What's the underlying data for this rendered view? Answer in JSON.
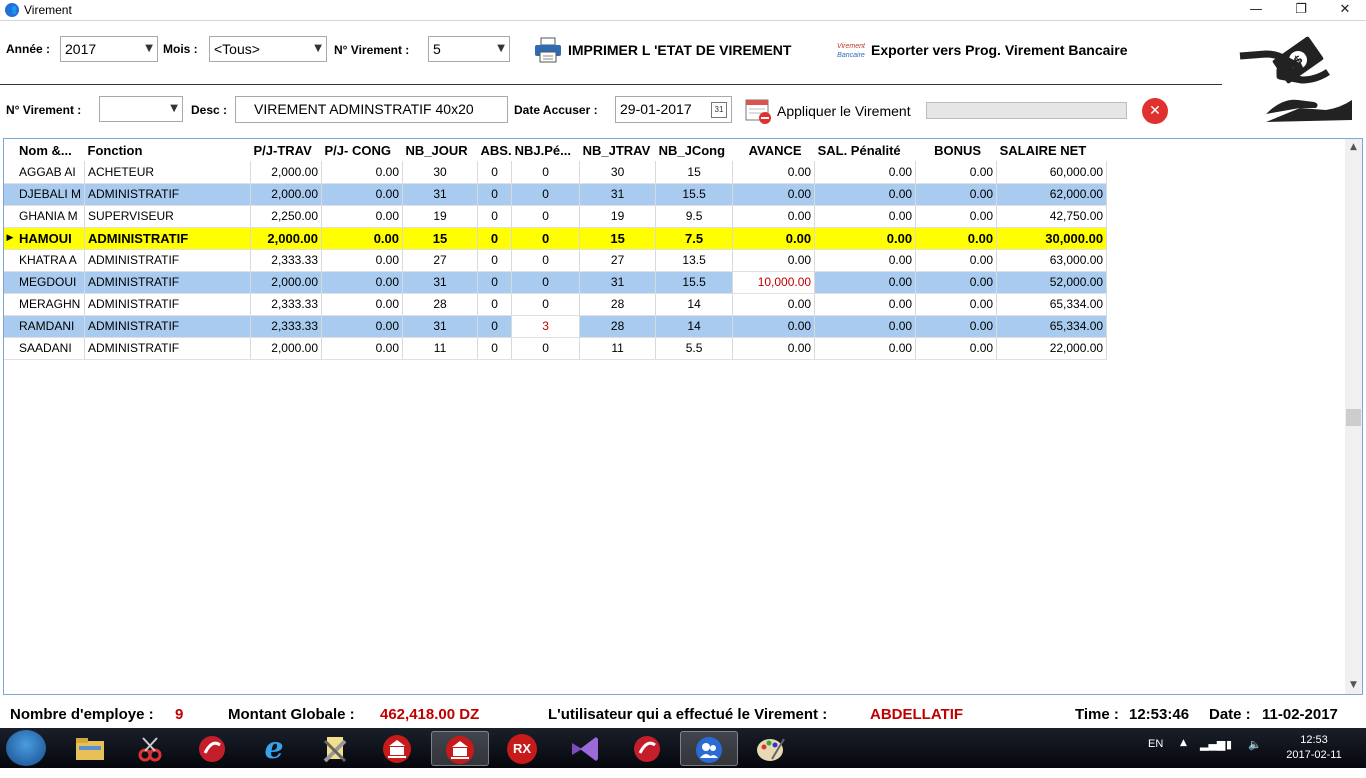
{
  "window": {
    "title": "Virement",
    "minimize": "—",
    "maximize": "❐",
    "close": "✕"
  },
  "filters": {
    "annee_label": "Année :",
    "annee_value": "2017",
    "mois_label": "Mois :",
    "mois_value": "<Tous>",
    "virement_label": "N° Virement :",
    "virement_value": "5"
  },
  "actions": {
    "print_label": "IMPRIMER L 'ETAT DE  VIREMENT",
    "export_label": "Exporter vers Prog. Virement Bancaire",
    "export_icon_text": "Virement Bancaire",
    "apply_label": "Appliquer le Virement"
  },
  "form": {
    "virement_label": "N° Virement :",
    "virement_value": "",
    "desc_label": "Desc :",
    "desc_value": "VIREMENT ADMINSTRATIF 40x20",
    "date_label": "Date Accuser :",
    "date_value": "29-01-2017",
    "calendar_icon_text": "31"
  },
  "grid": {
    "columns": [
      "Nom &...",
      "Fonction",
      "P/J-TRAV",
      "P/J- CONG",
      "NB_JOUR",
      "ABS.",
      "NBJ.Pé...",
      "NB_JTRAV",
      "NB_JCong",
      "AVANCE",
      "SAL. Pénalité",
      "BONUS",
      "SALAIRE NET"
    ],
    "rows": [
      {
        "nom": "AGGAB AI",
        "fonction": "ACHETEUR",
        "pj_trav": "2,000.00",
        "pj_cong": "0.00",
        "nb_jour": "30",
        "abs": "0",
        "nbj_pen": "0",
        "nb_jtrav": "30",
        "nb_jcong": "15",
        "avance": "0.00",
        "sal_pen": "0.00",
        "bonus": "0.00",
        "salaire": "60,000.00"
      },
      {
        "nom": "DJEBALI M",
        "fonction": "ADMINISTRATIF",
        "pj_trav": "2,000.00",
        "pj_cong": "0.00",
        "nb_jour": "31",
        "abs": "0",
        "nbj_pen": "0",
        "nb_jtrav": "31",
        "nb_jcong": "15.5",
        "avance": "0.00",
        "sal_pen": "0.00",
        "bonus": "0.00",
        "salaire": "62,000.00"
      },
      {
        "nom": "GHANIA M",
        "fonction": "SUPERVISEUR",
        "pj_trav": "2,250.00",
        "pj_cong": "0.00",
        "nb_jour": "19",
        "abs": "0",
        "nbj_pen": "0",
        "nb_jtrav": "19",
        "nb_jcong": "9.5",
        "avance": "0.00",
        "sal_pen": "0.00",
        "bonus": "0.00",
        "salaire": "42,750.00"
      },
      {
        "nom": "HAMOUI",
        "fonction": "ADMINISTRATIF",
        "pj_trav": "2,000.00",
        "pj_cong": "0.00",
        "nb_jour": "15",
        "abs": "0",
        "nbj_pen": "0",
        "nb_jtrav": "15",
        "nb_jcong": "7.5",
        "avance": "0.00",
        "sal_pen": "0.00",
        "bonus": "0.00",
        "salaire": "30,000.00"
      },
      {
        "nom": "KHATRA A",
        "fonction": "ADMINISTRATIF",
        "pj_trav": "2,333.33",
        "pj_cong": "0.00",
        "nb_jour": "27",
        "abs": "0",
        "nbj_pen": "0",
        "nb_jtrav": "27",
        "nb_jcong": "13.5",
        "avance": "0.00",
        "sal_pen": "0.00",
        "bonus": "0.00",
        "salaire": "63,000.00"
      },
      {
        "nom": "MEGDOUI",
        "fonction": "ADMINISTRATIF",
        "pj_trav": "2,000.00",
        "pj_cong": "0.00",
        "nb_jour": "31",
        "abs": "0",
        "nbj_pen": "0",
        "nb_jtrav": "31",
        "nb_jcong": "15.5",
        "avance": "10,000.00",
        "sal_pen": "0.00",
        "bonus": "0.00",
        "salaire": "52,000.00"
      },
      {
        "nom": "MERAGHN",
        "fonction": "ADMINISTRATIF",
        "pj_trav": "2,333.33",
        "pj_cong": "0.00",
        "nb_jour": "28",
        "abs": "0",
        "nbj_pen": "0",
        "nb_jtrav": "28",
        "nb_jcong": "14",
        "avance": "0.00",
        "sal_pen": "0.00",
        "bonus": "0.00",
        "salaire": "65,334.00"
      },
      {
        "nom": "RAMDANI",
        "fonction": "ADMINISTRATIF",
        "pj_trav": "2,333.33",
        "pj_cong": "0.00",
        "nb_jour": "31",
        "abs": "0",
        "nbj_pen": "3",
        "nb_jtrav": "28",
        "nb_jcong": "14",
        "avance": "0.00",
        "sal_pen": "0.00",
        "bonus": "0.00",
        "salaire": "65,334.00"
      },
      {
        "nom": "SAADANI",
        "fonction": "ADMINISTRATIF",
        "pj_trav": "2,000.00",
        "pj_cong": "0.00",
        "nb_jour": "11",
        "abs": "0",
        "nbj_pen": "0",
        "nb_jtrav": "11",
        "nb_jcong": "5.5",
        "avance": "0.00",
        "sal_pen": "0.00",
        "bonus": "0.00",
        "salaire": "22,000.00"
      }
    ]
  },
  "status": {
    "nb_employe_label": "Nombre d'employe :",
    "nb_employe_value": "9",
    "montant_label": "Montant Globale :",
    "montant_value": "462,418.00 DZ",
    "user_label": "L'utilisateur qui a effectué le Virement :",
    "user_value": "ABDELLATIF",
    "time_label": "Time :",
    "time_value": "12:53:46",
    "date_label": "Date :",
    "date_value": "11-02-2017"
  },
  "taskbar": {
    "items": [
      "folder-icon",
      "snipping-icon",
      "app-red-icon",
      "ie-icon",
      "tools-icon",
      "bank-icon",
      "bank-icon-2",
      "RX",
      "vs-icon",
      "app-red-icon-2",
      "users-icon",
      "paint-icon"
    ],
    "rx_label": "RX",
    "lang": "EN",
    "clock_time": "12:53",
    "clock_date": "2017-02-11"
  },
  "colors": {
    "accent_red": "#c00000",
    "row_alt": "#a9cbef",
    "row_current": "#ffff00",
    "close_button": "#e03030"
  }
}
